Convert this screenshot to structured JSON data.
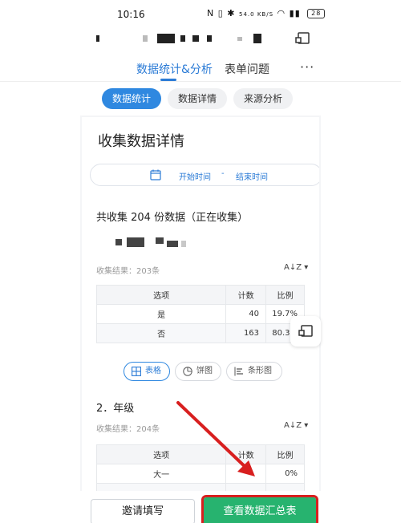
{
  "status_bar": {
    "time": "10:16",
    "network_speed": "54.0 KB/S",
    "battery": "28"
  },
  "top_tabs": [
    {
      "label": "数据统计&分析",
      "active": true
    },
    {
      "label": "表单问题",
      "active": false
    }
  ],
  "more_label": "···",
  "sub_tabs": [
    {
      "label": "数据统计",
      "active": true
    },
    {
      "label": "数据详情",
      "active": false
    },
    {
      "label": "来源分析",
      "active": false
    }
  ],
  "detail": {
    "title": "收集数据详情",
    "date_start": "开始时间",
    "date_sep": "-",
    "date_end": "结束时间",
    "total_text": "共收集 204 份数据（正在收集）"
  },
  "q1": {
    "result_label": "收集结果：203条",
    "columns": [
      "选项",
      "计数",
      "比例"
    ],
    "rows": [
      {
        "option": "是",
        "count": "40",
        "ratio": "19.7%"
      },
      {
        "option": "否",
        "count": "163",
        "ratio": "80.3%"
      }
    ]
  },
  "view_buttons": [
    {
      "label": "表格",
      "active": true,
      "icon": "table-icon"
    },
    {
      "label": "饼图",
      "active": false,
      "icon": "pie-chart-icon"
    },
    {
      "label": "条形图",
      "active": false,
      "icon": "bar-chart-icon"
    }
  ],
  "q2": {
    "title": "2．年级",
    "result_label": "收集结果：204条",
    "columns": [
      "选项",
      "计数",
      "比例"
    ],
    "rows": [
      {
        "option": "大一",
        "count": "",
        "ratio": "0%"
      }
    ]
  },
  "sort_label": "A↓Z ▾",
  "bottom": {
    "invite_label": "邀请填写",
    "summary_label": "查看数据汇总表"
  },
  "colors": {
    "accent": "#2b7bd6",
    "primary_button": "#27b36f",
    "annotation": "#d81f1f"
  }
}
